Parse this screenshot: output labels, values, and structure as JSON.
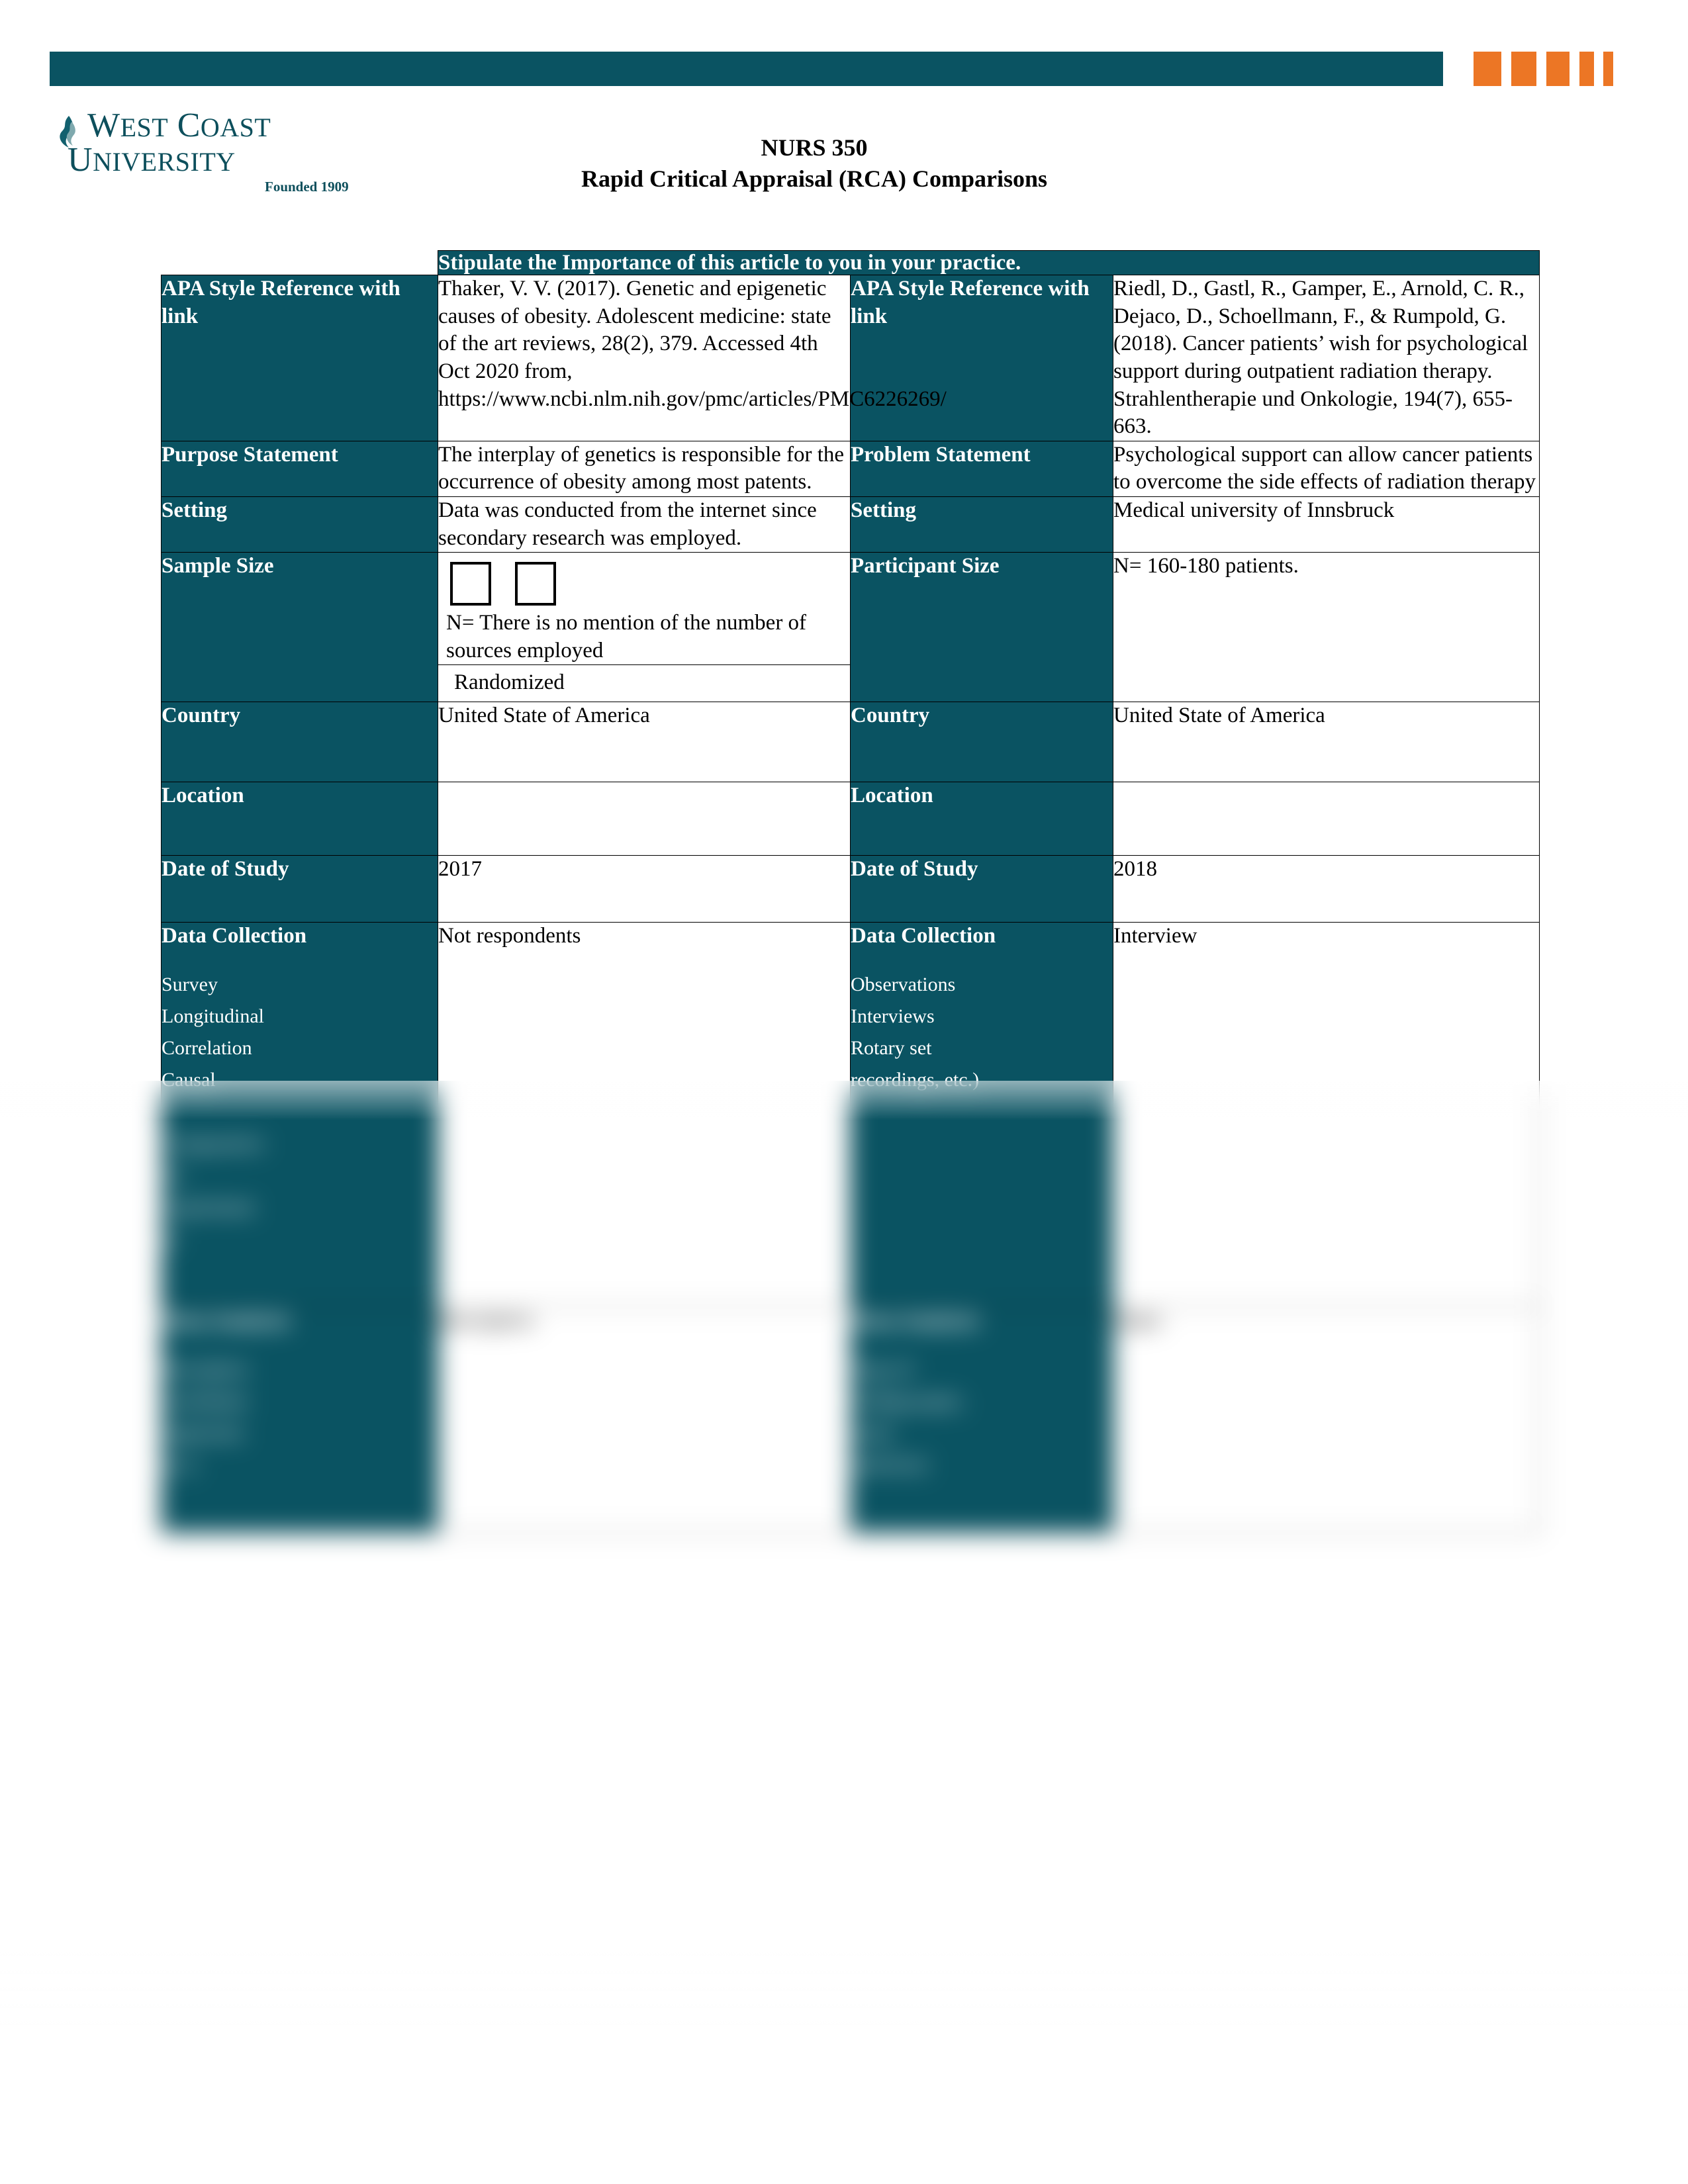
{
  "colors": {
    "teal": "#0a5362",
    "orange": "#ec7625",
    "logo_teal": "#0d4f5c",
    "text": "#000000",
    "cell_bg": "#ffffff"
  },
  "header_banner": {
    "bar_name": "teal-banner",
    "orange_bars": 5
  },
  "logo": {
    "line1": "West Coast",
    "line2": "University",
    "founded": "Founded 1909",
    "icon": "flame-icon"
  },
  "document": {
    "course": "NURS 350",
    "title": "Rapid Critical Appraisal (RCA) Comparisons"
  },
  "table": {
    "header": "Stipulate the Importance of this article to you in your practice.",
    "rows": [
      {
        "left_label": "APA Style Reference with link",
        "left_value": "Thaker, V. V. (2017). Genetic and epigenetic causes of obesity. Adolescent medicine: state of the art reviews, 28(2), 379. Accessed 4th Oct 2020 from, https://www.ncbi.nlm.nih.gov/pmc/articles/PMC6226269/",
        "right_label": "APA Style Reference with link",
        "right_value": "Riedl, D., Gastl, R., Gamper, E., Arnold, C. R., Dejaco, D., Schoellmann, F., & Rumpold, G. (2018). Cancer patients’ wish for psychological support during outpatient radiation therapy. Strahlentherapie und Onkologie, 194(7), 655-663."
      },
      {
        "left_label": "Purpose Statement",
        "left_value": "The interplay of genetics is responsible for the occurrence of obesity among most patents.",
        "right_label": "Problem Statement",
        "right_value": "Psychological support can allow cancer patients to overcome the side effects of radiation therapy"
      },
      {
        "left_label": "Setting",
        "left_value": "Data was conducted from the internet since secondary research was employed.",
        "right_label": "Setting",
        "right_value": "Medical university of Innsbruck"
      },
      {
        "left_label": "Sample Size",
        "left_value": "N= There is no mention of the number of sources employed",
        "left_sub": "Randomized",
        "left_checkbox_count": 2,
        "right_label": "Participant Size",
        "right_value": "N= 160-180 patients."
      }
    ],
    "redacted_rows": [
      {
        "left_label": "Country",
        "right_label": "Country"
      },
      {
        "left_label": "Location",
        "right_label": "Location"
      },
      {
        "left_label": "Date of Study",
        "right_label": "Date of Study"
      },
      {
        "left_label": "Data Collection",
        "right_label": "Data Collection"
      },
      {
        "left_label": "Data Analysis",
        "right_label": "Data Analysis"
      }
    ]
  }
}
